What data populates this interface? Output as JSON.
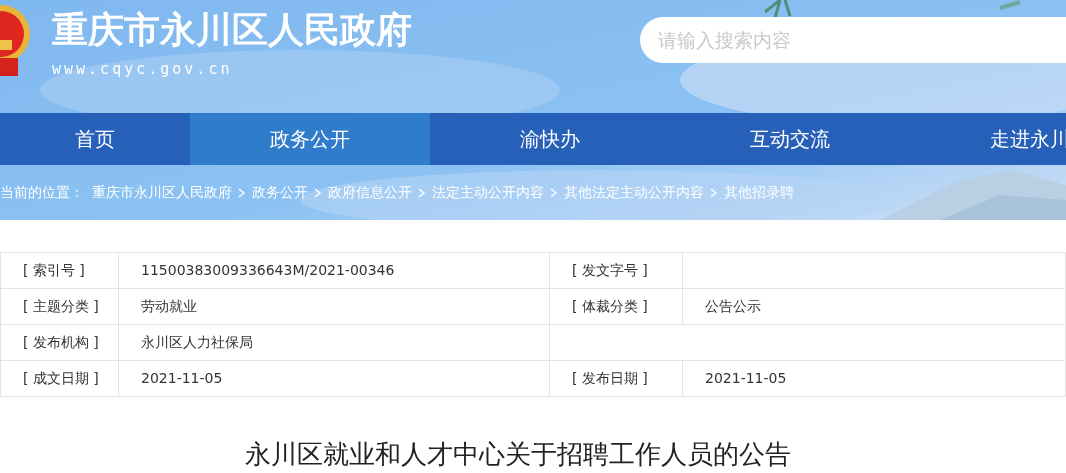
{
  "site": {
    "title": "重庆市永川区人民政府",
    "url": "www.cqyc.gov.cn"
  },
  "search": {
    "placeholder": "请输入搜索内容"
  },
  "nav": [
    {
      "label": "首页",
      "selected": false
    },
    {
      "label": "政务公开",
      "selected": true
    },
    {
      "label": "渝快办",
      "selected": false
    },
    {
      "label": "互动交流",
      "selected": false
    },
    {
      "label": "走进永川",
      "selected": false
    }
  ],
  "breadcrumb": {
    "prefix": "当前的位置：",
    "items": [
      "重庆市永川区人民政府",
      "政务公开",
      "政府信息公开",
      "法定主动公开内容",
      "其他法定主动公开内容",
      "其他招录聘"
    ]
  },
  "info_table": [
    {
      "label": "[ 索引号 ]",
      "value": "11500383009336643M/2021-00346",
      "label_2": "[ 发文字号 ]"
    },
    {
      "label": "[ 主题分类 ]",
      "value": "劳动就业",
      "label_2": "[ 体裁分类 ]",
      "value_2": "公告公示"
    },
    {
      "label": "[ 发布机构 ]",
      "value": "永川区人力社保局"
    },
    {
      "label": "[ 成文日期 ]",
      "value": "2021-11-05",
      "label_2": "[ 发布日期 ]",
      "value_2": "2021-11-05"
    }
  ],
  "article_title": "永川区就业和人才中心关于招聘工作人员的公告"
}
